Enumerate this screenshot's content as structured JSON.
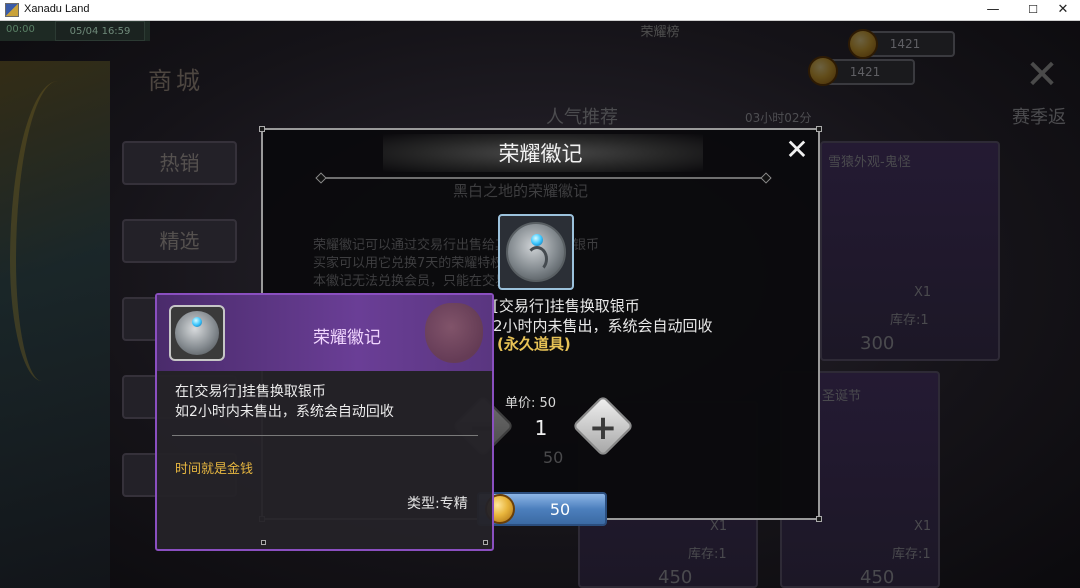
{
  "window": {
    "title": "Xanadu Land",
    "minimize_glyph": "—",
    "maximize_glyph": "☐",
    "close_glyph": "✕"
  },
  "hud": {
    "status_text": "00:00",
    "time_text": "05/04 16:59",
    "center_title": "荣耀榜"
  },
  "shop": {
    "title": "商城",
    "tabs": [
      {
        "label": "热销"
      },
      {
        "label": "精选"
      }
    ],
    "currency_top": "1421",
    "currency_bottom": "1421",
    "close_glyph": "✕",
    "section_popular": "人气推荐",
    "section_season": "赛季返",
    "timer": "03小时02分"
  },
  "background_cards": {
    "labels": [
      "X1",
      "库存:1",
      "300",
      "X1",
      "库存:1",
      "450",
      "X1",
      "库存:1",
      "450"
    ],
    "skin_title": "雪猿外观-鬼怪",
    "event_title": "圣诞节"
  },
  "modal": {
    "title": "荣耀徽记",
    "close_glyph": "✕",
    "ghost_subtitle": "黑白之地的荣耀徽记",
    "ghost_lines": [
      "荣耀徽记可以通过交易行出售给其他玩家换取银币",
      "买家可以用它兑换7天的荣耀特权",
      "本徽记无法兑换会员，只能在交易行中出售。"
    ],
    "desc_line1": "在[交易行]挂售换取银币",
    "desc_line2": "如2小时内未售出，系统会自动回收",
    "permanent_label": "(永久道具)",
    "unit_price_label": "单价: 50",
    "quantity": "1",
    "minus_glyph": "−",
    "plus_glyph": "+",
    "buy_price": "50",
    "ghost_price": "50"
  },
  "tooltip": {
    "title": "荣耀徽记",
    "desc_line1": "在[交易行]挂售换取银币",
    "desc_line2": "如2小时内未售出，系统会自动回收",
    "flavor": "时间就是金钱",
    "type": "类型:专精"
  },
  "colors": {
    "accent_purple": "#6a3e96",
    "gold": "#e7c256",
    "button_blue": "#4c7fbd"
  }
}
